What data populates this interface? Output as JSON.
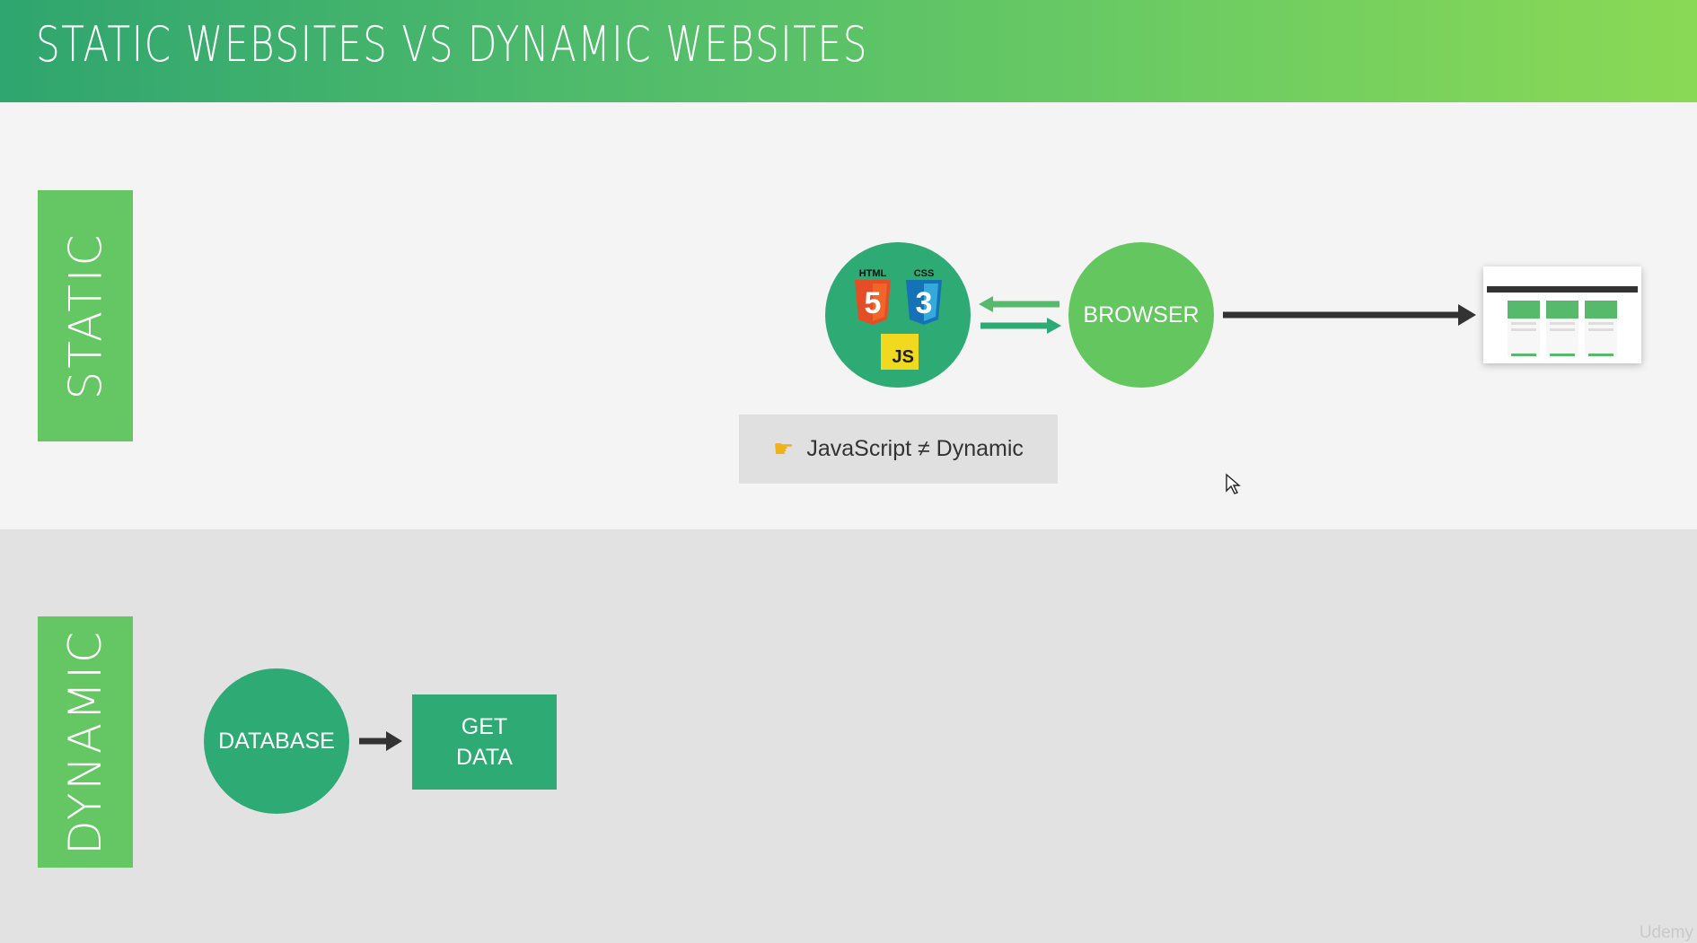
{
  "header": {
    "title": "STATIC WEBSITES VS DYNAMIC WEBSITES"
  },
  "static_section": {
    "label": "STATIC",
    "tech_icons": {
      "html_label": "HTML",
      "html_glyph": "5",
      "css_label": "CSS",
      "css_glyph": "3",
      "js_label": "JS"
    },
    "browser_label": "BROWSER",
    "note": {
      "icon": "pointing-hand-icon",
      "text": "JavaScript ≠ Dynamic"
    }
  },
  "dynamic_section": {
    "label": "DYNAMIC",
    "database_label": "DATABASE",
    "get_data_line1": "GET",
    "get_data_line2": "DATA"
  },
  "watermark": "Udemy",
  "colors": {
    "dark_green": "#2eaa75",
    "light_green": "#63c65e",
    "label_green": "#65c763",
    "arrow_dark": "#333333"
  }
}
